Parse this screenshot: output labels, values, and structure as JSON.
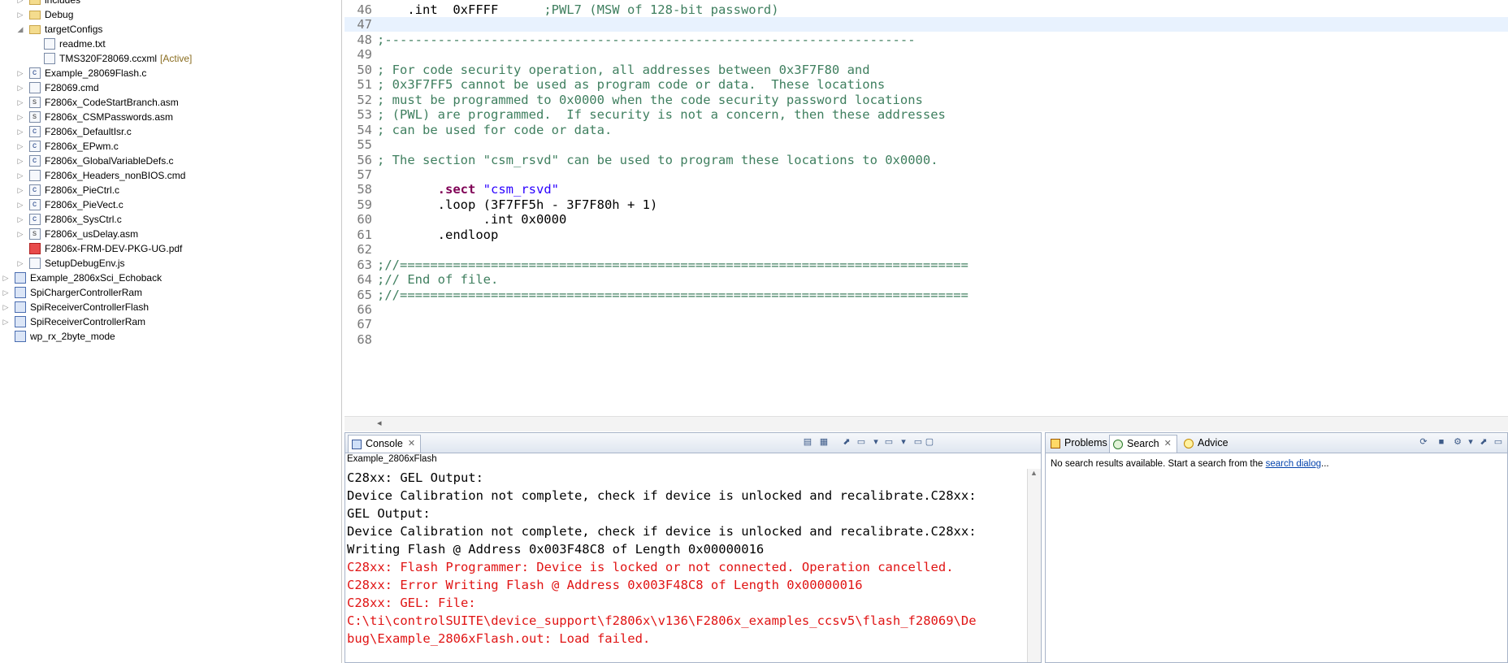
{
  "explorer": {
    "items": [
      {
        "label": "includes",
        "icon": "folder-icon",
        "expand": "▷"
      },
      {
        "label": "Debug",
        "icon": "folder-icon",
        "expand": "▷"
      },
      {
        "label": "targetConfigs",
        "icon": "folder-icon",
        "expand": "◢"
      },
      {
        "label": "readme.txt",
        "icon": "text-file-icon",
        "expand": ""
      },
      {
        "label": "TMS320F28069.ccxml",
        "icon": "xml-file-icon",
        "expand": "",
        "tag": "[Active]"
      },
      {
        "label": "Example_28069Flash.c",
        "icon": "c-file-icon",
        "expand": "▷"
      },
      {
        "label": "F28069.cmd",
        "icon": "cmd-file-icon",
        "expand": "▷"
      },
      {
        "label": "F2806x_CodeStartBranch.asm",
        "icon": "asm-file-icon",
        "expand": "▷"
      },
      {
        "label": "F2806x_CSMPasswords.asm",
        "icon": "asm-file-icon",
        "expand": "▷"
      },
      {
        "label": "F2806x_DefaultIsr.c",
        "icon": "c-file-icon",
        "expand": "▷"
      },
      {
        "label": "F2806x_EPwm.c",
        "icon": "c-file-icon",
        "expand": "▷"
      },
      {
        "label": "F2806x_GlobalVariableDefs.c",
        "icon": "c-file-icon",
        "expand": "▷"
      },
      {
        "label": "F2806x_Headers_nonBIOS.cmd",
        "icon": "cmd-file-icon",
        "expand": "▷"
      },
      {
        "label": "F2806x_PieCtrl.c",
        "icon": "c-file-icon",
        "expand": "▷"
      },
      {
        "label": "F2806x_PieVect.c",
        "icon": "c-file-icon",
        "expand": "▷"
      },
      {
        "label": "F2806x_SysCtrl.c",
        "icon": "c-file-icon",
        "expand": "▷"
      },
      {
        "label": "F2806x_usDelay.asm",
        "icon": "asm-file-icon",
        "expand": "▷"
      },
      {
        "label": "F2806x-FRM-DEV-PKG-UG.pdf",
        "icon": "pdf-file-icon",
        "expand": ""
      },
      {
        "label": "SetupDebugEnv.js",
        "icon": "js-file-icon",
        "expand": "▷"
      },
      {
        "label": "Example_2806xSci_Echoback",
        "icon": "project-icon",
        "expand": "▷"
      },
      {
        "label": "SpiChargerControllerRam",
        "icon": "project-icon",
        "expand": "▷"
      },
      {
        "label": "SpiReceiverControllerFlash",
        "icon": "project-icon",
        "expand": "▷"
      },
      {
        "label": "SpiReceiverControllerRam",
        "icon": "project-icon",
        "expand": "▷"
      },
      {
        "label": "wp_rx_2byte_mode",
        "icon": "closed-project-icon",
        "expand": ""
      }
    ]
  },
  "editor": {
    "lines": [
      {
        "num": "46",
        "parts": [
          {
            "t": "    .int  0xFFFF      ",
            "c": "code"
          },
          {
            "t": ";PWL7 (MSW of 128-bit password)",
            "c": "cm"
          }
        ]
      },
      {
        "num": "47",
        "parts": [],
        "current": true
      },
      {
        "num": "48",
        "parts": [
          {
            "t": ";----------------------------------------------------------------------",
            "c": "cm"
          }
        ]
      },
      {
        "num": "49",
        "parts": []
      },
      {
        "num": "50",
        "parts": [
          {
            "t": "; For code security operation, all addresses between 0x3F7F80 and",
            "c": "cm"
          }
        ]
      },
      {
        "num": "51",
        "parts": [
          {
            "t": "; 0x3F7FF5 cannot be used as program code or data.  These locations",
            "c": "cm"
          }
        ]
      },
      {
        "num": "52",
        "parts": [
          {
            "t": "; must be programmed to 0x0000 when the code security password locations",
            "c": "cm"
          }
        ]
      },
      {
        "num": "53",
        "parts": [
          {
            "t": "; (PWL) are programmed.  If security is not a concern, then these addresses",
            "c": "cm"
          }
        ]
      },
      {
        "num": "54",
        "parts": [
          {
            "t": "; can be used for code or data.",
            "c": "cm"
          }
        ]
      },
      {
        "num": "55",
        "parts": []
      },
      {
        "num": "56",
        "parts": [
          {
            "t": "; The section \"csm_rsvd\" can be used to program these locations to 0x0000.",
            "c": "cm"
          }
        ]
      },
      {
        "num": "57",
        "parts": []
      },
      {
        "num": "58",
        "parts": [
          {
            "t": "        ",
            "c": "code"
          },
          {
            "t": ".sect",
            "c": "kw"
          },
          {
            "t": " ",
            "c": "code"
          },
          {
            "t": "\"csm_rsvd\"",
            "c": "str"
          }
        ]
      },
      {
        "num": "59",
        "parts": [
          {
            "t": "        .loop (3F7FF5h - 3F7F80h + 1)",
            "c": "code"
          }
        ]
      },
      {
        "num": "60",
        "parts": [
          {
            "t": "              .int 0x0000",
            "c": "code"
          }
        ]
      },
      {
        "num": "61",
        "parts": [
          {
            "t": "        .endloop",
            "c": "code"
          }
        ]
      },
      {
        "num": "62",
        "parts": []
      },
      {
        "num": "63",
        "parts": [
          {
            "t": ";//===========================================================================",
            "c": "cm"
          }
        ]
      },
      {
        "num": "64",
        "parts": [
          {
            "t": ";// End of file.",
            "c": "cm"
          }
        ]
      },
      {
        "num": "65",
        "parts": [
          {
            "t": ";//===========================================================================",
            "c": "cm"
          }
        ]
      },
      {
        "num": "66",
        "parts": []
      },
      {
        "num": "67",
        "parts": []
      },
      {
        "num": "68",
        "parts": []
      }
    ],
    "scroll_left_glyph": "◂"
  },
  "console": {
    "tab_label": "Console",
    "close_glyph": "✕",
    "title": "Example_2806xFlash",
    "lines": [
      {
        "t": "C28xx: GEL Output:",
        "c": "out"
      },
      {
        "t": "Device Calibration not complete, check if device is unlocked and recalibrate.C28xx:",
        "c": "out"
      },
      {
        "t": "GEL Output:",
        "c": "out"
      },
      {
        "t": "Device Calibration not complete, check if device is unlocked and recalibrate.C28xx:",
        "c": "out"
      },
      {
        "t": "Writing Flash @ Address 0x003F48C8 of Length 0x00000016",
        "c": "out"
      },
      {
        "t": "C28xx: Flash Programmer: Device is locked or not connected. Operation cancelled.",
        "c": "err"
      },
      {
        "t": "C28xx: Error Writing Flash @ Address 0x003F48C8 of Length 0x00000016",
        "c": "err"
      },
      {
        "t": "C28xx: GEL: File:",
        "c": "err"
      },
      {
        "t": "C:\\ti\\controlSUITE\\device_support\\f2806x\\v136\\F2806x_examples_ccsv5\\flash_f28069\\De",
        "c": "err"
      },
      {
        "t": "bug\\Example_2806xFlash.out: Load failed.",
        "c": "err"
      }
    ],
    "toolbar_glyphs": [
      "▤",
      "▦",
      "⬈",
      "▭",
      "▾",
      "▭",
      "▾",
      "▭",
      "▢"
    ],
    "scroll_up_glyph": "▲"
  },
  "search_view": {
    "tabs": [
      {
        "label": "Problems",
        "icon": "problems-icon"
      },
      {
        "label": "Search",
        "icon": "search-icon",
        "close": "✕"
      },
      {
        "label": "Advice",
        "icon": "advice-icon"
      }
    ],
    "message_prefix": "No search results available. Start a search from the ",
    "message_link": "search dialog",
    "message_suffix": "...",
    "toolbar_glyphs": [
      "⟳",
      "■",
      "⚙",
      "▾",
      "⬈",
      "▭"
    ]
  }
}
